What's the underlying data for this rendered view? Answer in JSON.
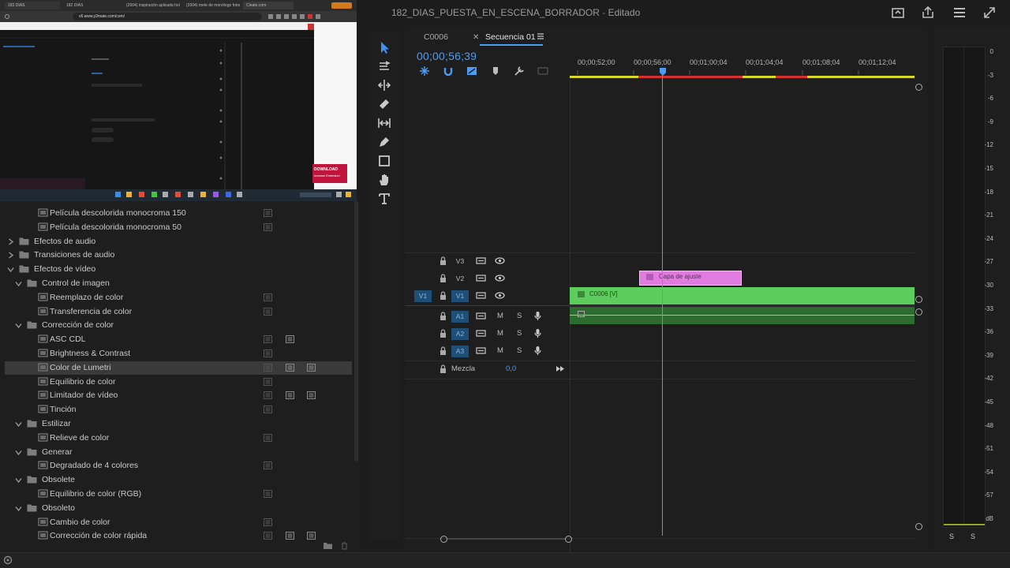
{
  "project": {
    "title": "182_DIAS_PUESTA_EN_ESCENA_BORRADOR",
    "separator": "-",
    "status": "Editado"
  },
  "top_icons": [
    "quick-export-icon",
    "share-icon",
    "workspaces-menu-icon",
    "fullscreen-icon"
  ],
  "browser": {
    "tabs": [
      "182 DIAS",
      "182 DIAS",
      "(2004) inspiración aplicada hol",
      "(2004) mete de monólogo fotoes",
      "Cleate.com"
    ],
    "url": "v6.www.y2mate.com/com/",
    "download_label": "DOWNLOAD",
    "download_sub": "Incease Extension"
  },
  "effects": {
    "items": [
      {
        "label": "Película descolorida monocroma 150",
        "indent": 2,
        "type": "effect",
        "badges": 1
      },
      {
        "label": "Película descolorida monocroma 50",
        "indent": 2,
        "type": "effect",
        "badges": 1
      },
      {
        "label": "Efectos de audio",
        "indent": 0,
        "type": "folder",
        "expanded": false
      },
      {
        "label": "Transiciones de audio",
        "indent": 0,
        "type": "folder",
        "expanded": false
      },
      {
        "label": "Efectos de vídeo",
        "indent": 0,
        "type": "folder",
        "expanded": true
      },
      {
        "label": "Control de imagen",
        "indent": 1,
        "type": "folder",
        "expanded": true
      },
      {
        "label": "Reemplazo de color",
        "indent": 2,
        "type": "effect",
        "badges": 1
      },
      {
        "label": "Transferencia de color",
        "indent": 2,
        "type": "effect",
        "badges": 1
      },
      {
        "label": "Corrección de color",
        "indent": 1,
        "type": "folder",
        "expanded": true
      },
      {
        "label": "ASC CDL",
        "indent": 2,
        "type": "effect",
        "badges": 2
      },
      {
        "label": "Brightness & Contrast",
        "indent": 2,
        "type": "effect",
        "badges": 1
      },
      {
        "label": "Color de Lumetri",
        "indent": 2,
        "type": "effect",
        "badges": 3,
        "selected": true
      },
      {
        "label": "Equilibrio de color",
        "indent": 2,
        "type": "effect",
        "badges": 1
      },
      {
        "label": "Limitador de vídeo",
        "indent": 2,
        "type": "effect",
        "badges": 3
      },
      {
        "label": "Tinción",
        "indent": 2,
        "type": "effect",
        "badges": 1
      },
      {
        "label": "Estilizar",
        "indent": 1,
        "type": "folder",
        "expanded": true
      },
      {
        "label": "Relieve de color",
        "indent": 2,
        "type": "effect",
        "badges": 1
      },
      {
        "label": "Generar",
        "indent": 1,
        "type": "folder",
        "expanded": true
      },
      {
        "label": "Degradado de 4 colores",
        "indent": 2,
        "type": "effect",
        "badges": 1
      },
      {
        "label": "Obsolete",
        "indent": 1,
        "type": "folder",
        "expanded": true
      },
      {
        "label": "Equilibrio de color (RGB)",
        "indent": 2,
        "type": "effect",
        "badges": 1
      },
      {
        "label": "Obsoleto",
        "indent": 1,
        "type": "folder",
        "expanded": true
      },
      {
        "label": "Cambio de color",
        "indent": 2,
        "type": "effect",
        "badges": 1
      },
      {
        "label": "Corrección de color rápida",
        "indent": 2,
        "type": "effect",
        "badges": 3
      }
    ]
  },
  "tools": [
    "selection-tool-icon",
    "track-select-tool-icon",
    "ripple-edit-tool-icon",
    "razor-tool-icon",
    "slip-tool-icon",
    "pen-tool-icon",
    "rectangle-tool-icon",
    "hand-tool-icon",
    "type-tool-icon"
  ],
  "timeline": {
    "tabs": [
      {
        "label": "C0006",
        "active": false
      },
      {
        "label": "Secuencia 01",
        "active": true
      }
    ],
    "timecode": "00;00;56;39",
    "ruler_labels": [
      "00;00;52;00",
      "00;00;56;00",
      "00;01;00;04",
      "00;01;04;04",
      "00;01;08;04",
      "00;01;12;04"
    ],
    "video_tracks": [
      {
        "name": "V3",
        "target": ""
      },
      {
        "name": "V2",
        "target": ""
      },
      {
        "name": "V1",
        "target": "V1"
      }
    ],
    "audio_tracks": [
      {
        "name": "A1",
        "target": "A1",
        "m": "M",
        "s": "S"
      },
      {
        "name": "A2",
        "target": "",
        "m": "M",
        "s": "S"
      },
      {
        "name": "A3",
        "target": "",
        "m": "M",
        "s": "S"
      }
    ],
    "mix": {
      "label": "Mezcla",
      "value": "0,0"
    },
    "clips": {
      "adjustment": "Capa de ajuste",
      "video": "C0006 [V]"
    },
    "colors": {
      "accent": "#4a9cf5",
      "video_clip": "#5ccc5c",
      "adjustment_clip": "#e07ce0",
      "render_yellow": "#d8d82a",
      "render_red": "#d43030"
    }
  },
  "meter": {
    "labels": [
      "0",
      "-3",
      "-6",
      "-9",
      "-12",
      "-15",
      "-18",
      "-21",
      "-24",
      "-27",
      "-30",
      "-33",
      "-36",
      "-39",
      "-42",
      "-45",
      "-48",
      "-51",
      "-54",
      "-57",
      "dB"
    ],
    "solo_left": "S",
    "solo_right": "S"
  }
}
